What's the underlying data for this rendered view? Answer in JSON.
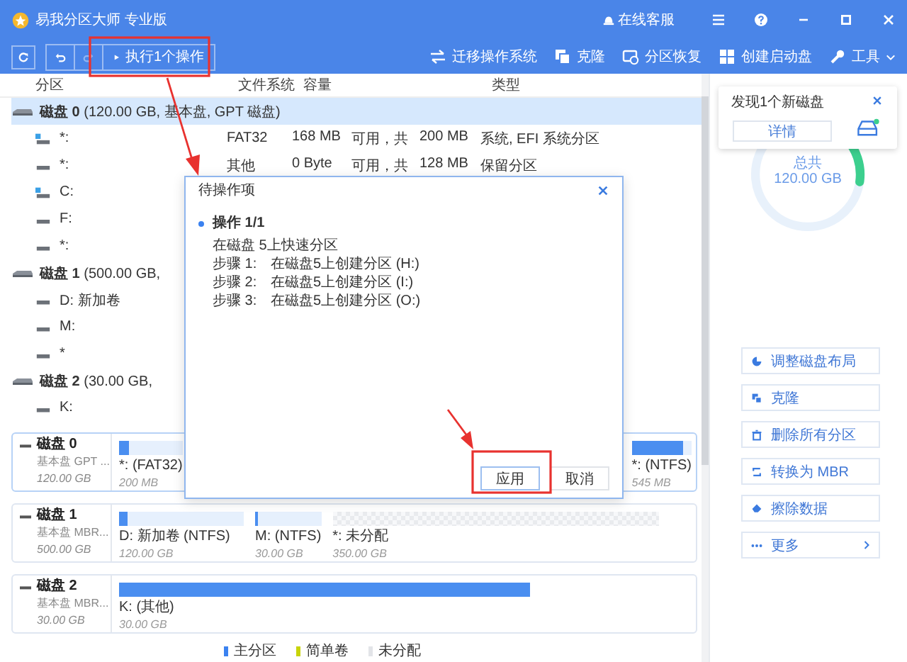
{
  "window": {
    "title": "易我分区大师 专业版",
    "service": "在线客服"
  },
  "toolbar": {
    "run_button": "执行1个操作",
    "redo_disabled": true,
    "actions": [
      "迁移操作系统",
      "克隆",
      "分区恢复",
      "创建启动盘",
      "工具"
    ]
  },
  "table": {
    "columns": [
      "分区",
      "文件系统",
      "容量",
      "类型"
    ],
    "rows": [
      {
        "kind": "disk",
        "label": "**磁盘 0** (120.00 GB, 基本盘, GPT 磁盘)",
        "selected": true
      },
      {
        "kind": "system_partition",
        "name": "*:",
        "fs": "FAT32",
        "free": "168 MB",
        "free_label": "可用，共",
        "total": "200 MB",
        "type": "系统, EFI 系统分区",
        "selected": false
      },
      {
        "kind": "partition",
        "name": "*:",
        "fs": "其他",
        "free": "0 Byte",
        "free_label": "可用，共",
        "total": "128 MB",
        "type": "保留分区",
        "selected": false
      },
      {
        "kind": "system_partition",
        "name": "C:",
        "selected": false
      },
      {
        "kind": "partition",
        "name": "F:",
        "selected": false
      },
      {
        "kind": "partition",
        "name": "*:",
        "selected": false
      },
      {
        "kind": "disk",
        "label": "**磁盘 1** (500.00 GB,",
        "selected": false
      },
      {
        "kind": "partition",
        "name": "D: 新加卷",
        "selected": false
      },
      {
        "kind": "partition",
        "name": "M:",
        "selected": false
      },
      {
        "kind": "partition",
        "name": "*",
        "selected": false
      },
      {
        "kind": "disk",
        "label": "**磁盘 2** (30.00 GB,",
        "selected": false
      },
      {
        "kind": "partition",
        "name": "K:",
        "selected": false
      }
    ]
  },
  "disk_map": [
    {
      "name": "磁盘 0",
      "type": "基本盘 GPT ...",
      "size": "120.00 GB",
      "partitions": [
        {
          "kind": "primary",
          "label": "*: (FAT32)",
          "size": "200 MB",
          "level": 0.15
        },
        {
          "kind": "primary",
          "label": "*: (NTFS)",
          "size": "545 MB",
          "level": 0.85
        }
      ]
    },
    {
      "name": "磁盘 1",
      "type": "基本盘 MBR...",
      "size": "500.00 GB",
      "partitions": [
        {
          "kind": "primary",
          "label": "D: 新加卷 (NTFS)",
          "size": "120.00 GB",
          "level": 0.07
        },
        {
          "kind": "primary",
          "label": "M: (NTFS)",
          "size": "30.00 GB",
          "level": 0.04
        },
        {
          "kind": "unallocated",
          "label": "*: 未分配",
          "size": "350.00 GB"
        }
      ]
    },
    {
      "name": "磁盘 2",
      "type": "基本盘 MBR...",
      "size": "30.00 GB",
      "partitions": [
        {
          "kind": "primary",
          "label": "K: (其他)",
          "size": "30.00 GB",
          "level": 1
        }
      ]
    }
  ],
  "legend": [
    {
      "label": "主分区",
      "color": "#3b82f0"
    },
    {
      "label": "简单卷",
      "color": "#c8d40a"
    },
    {
      "label": "未分配",
      "color": "#e2e4e8"
    }
  ],
  "side_panel": {
    "notice": {
      "text": "发现1个新磁盘",
      "button": "详情"
    },
    "total_label": "总共",
    "total": "120.00 GB",
    "actions": [
      {
        "kind": "layout",
        "label": "调整磁盘布局"
      },
      {
        "kind": "clone",
        "label": "克隆"
      },
      {
        "kind": "delete",
        "label": "删除所有分区"
      },
      {
        "kind": "convert",
        "label": "转换为 MBR"
      },
      {
        "kind": "wipe",
        "label": "擦除数据"
      },
      {
        "kind": "more",
        "label": "更多"
      }
    ]
  },
  "dialog": {
    "title": "待操作项",
    "heading": "操作 1/1",
    "summary": "在磁盘 5上快速分区",
    "steps": [
      {
        "label": "步骤 1:",
        "text": "在磁盘5上创建分区 (H:)"
      },
      {
        "label": "步骤 2:",
        "text": "在磁盘5上创建分区 (I:)"
      },
      {
        "label": "步骤 3:",
        "text": "在磁盘5上创建分区 (O:)"
      }
    ],
    "buttons": [
      {
        "label": "应用",
        "primary": true
      },
      {
        "label": "取消",
        "primary": false
      }
    ]
  }
}
